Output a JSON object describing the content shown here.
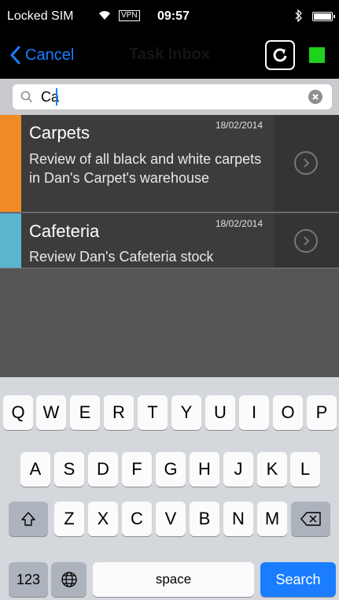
{
  "status_bar": {
    "carrier": "Locked SIM",
    "vpn": "VPN",
    "time": "09:57"
  },
  "nav": {
    "back_label": "Cancel",
    "title": "Task Inbox"
  },
  "search": {
    "value": "Ca"
  },
  "tasks": [
    {
      "title": "Carpets",
      "date": "18/02/2014",
      "description": "Review of all black and white carpets in Dan's Carpet's warehouse",
      "color": "#f08a24"
    },
    {
      "title": "Cafeteria",
      "date": "18/02/2014",
      "description": "Review Dan's Cafeteria stock",
      "color": "#5ab5cf"
    }
  ],
  "keyboard": {
    "row1": [
      "Q",
      "W",
      "E",
      "R",
      "T",
      "Y",
      "U",
      "I",
      "O",
      "P"
    ],
    "row2": [
      "A",
      "S",
      "D",
      "F",
      "G",
      "H",
      "J",
      "K",
      "L"
    ],
    "row3": [
      "Z",
      "X",
      "C",
      "V",
      "B",
      "N",
      "M"
    ],
    "numbers_label": "123",
    "space_label": "space",
    "search_label": "Search",
    "accent_color": "#1a7dff"
  }
}
